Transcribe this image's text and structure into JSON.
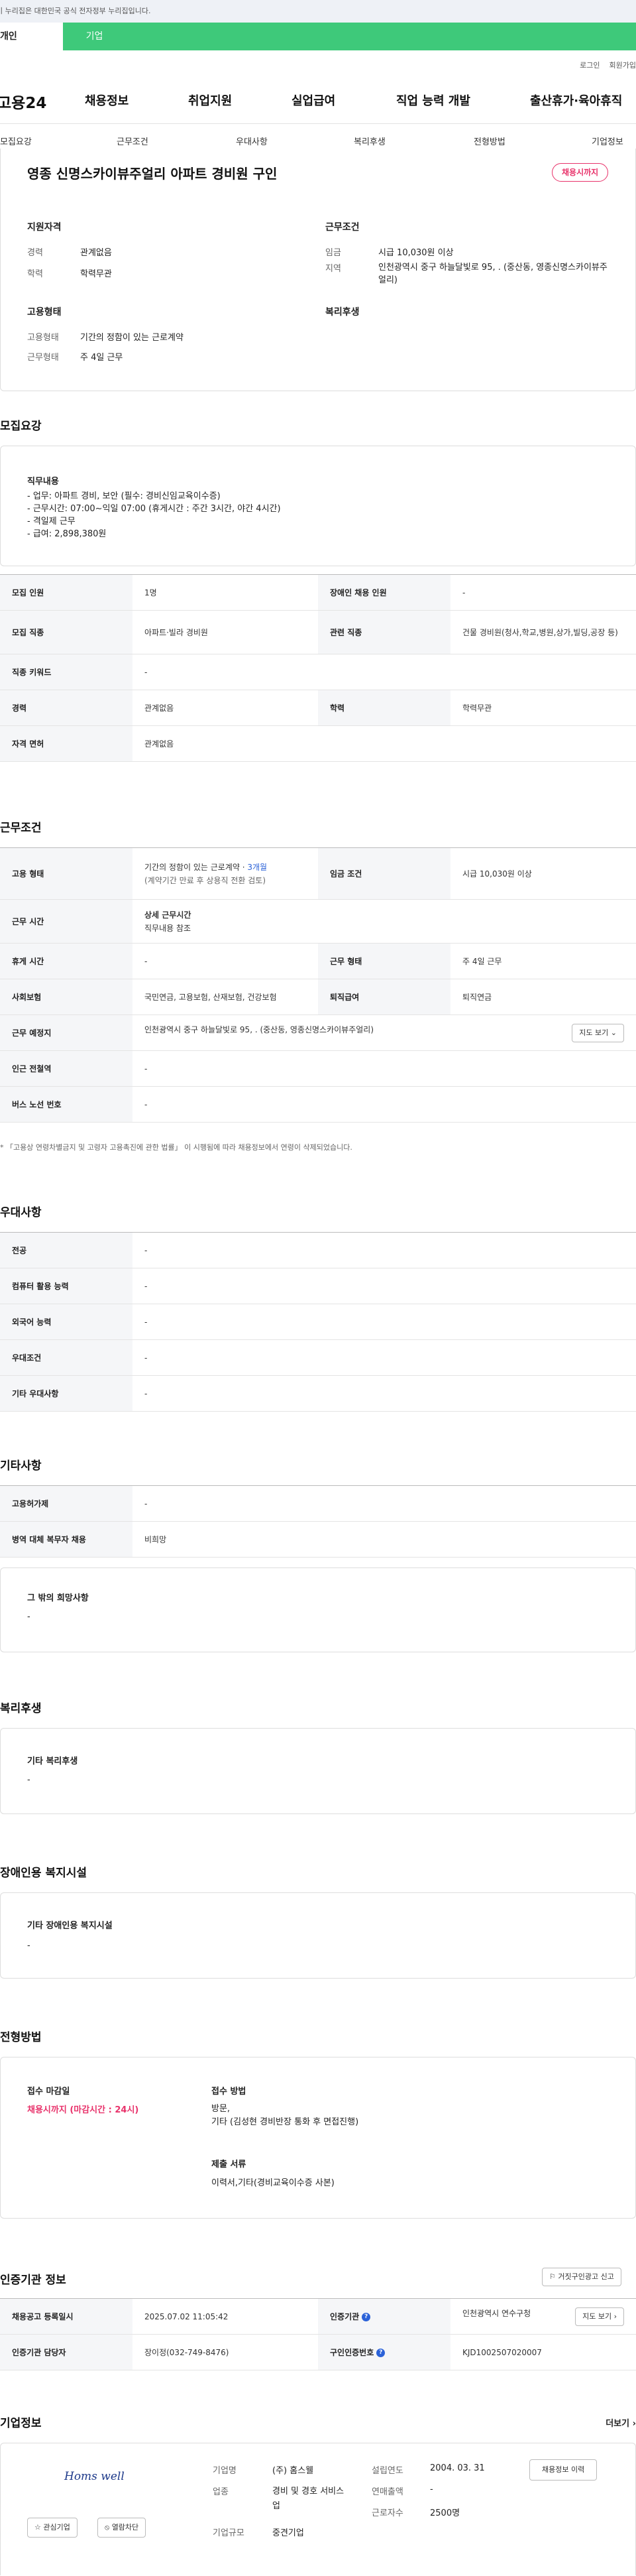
{
  "gov_banner": "이 누리집은 대한민국 공식 전자정부 누리집입니다.",
  "user_tabs": [
    "개인",
    "기업"
  ],
  "header": {
    "logo": "고용24",
    "util": [
      "로그인",
      "회원가입"
    ],
    "gnb": [
      "채용정보",
      "취업지원",
      "실업급여",
      "직업 능력 개발",
      "출산휴가·육아휴직"
    ]
  },
  "snb": [
    "모집요강",
    "근무조건",
    "우대사항",
    "복리후생",
    "전형방법",
    "기업정보"
  ],
  "job": {
    "title": "영종 신명스카이뷰주얼리 아파트 경비원 구인",
    "badge": "채용시까지",
    "qual_head": "지원자격",
    "exp_label": "경력",
    "exp": "관계없음",
    "edu_label": "학력",
    "edu": "학력무관",
    "work_head": "근무조건",
    "wage_label": "임금",
    "wage": "시급 10,030원 이상",
    "region_label": "지역",
    "region": "인천광역시 중구 하늘달빛로 95, . (중산동, 영종신명스카이뷰주얼리)",
    "emp_head": "고용형태",
    "type_label": "고용형태",
    "type": "기간의 정함이 있는 근로계약",
    "days_label": "근무형태",
    "days": "주 4일 근무",
    "welfare_head": "복리후생"
  },
  "recruit": {
    "section": "모집요강",
    "duty_head": "직무내용",
    "duty_lines": [
      "- 업무: 아파트 경비, 보안 (필수: 경비신임교육이수증)",
      "- 근무시간: 07:00~익일 07:00 (휴게시간 : 주간 3시간, 야간 4시간)",
      "- 격일제 근무",
      "- 급여: 2,898,380원"
    ],
    "rows": [
      [
        "모집 인원",
        "1명",
        "장애인 채용 인원",
        "-"
      ],
      [
        "모집 직종",
        "아파트·빌라 경비원",
        "관련 직종",
        "건물 경비원(청사,학교,병원,상가,빌딩,공장 등)"
      ],
      [
        "직종 키워드",
        "-",
        "",
        ""
      ],
      [
        "경력",
        "관계없음",
        "학력",
        "학력무관"
      ],
      [
        "자격 면허",
        "관계없음",
        "",
        ""
      ]
    ]
  },
  "work": {
    "section": "근무조건",
    "contract": "기간의 정함이 있는 근로계약 · ",
    "contract_len": "3개월",
    "contract_note": "(계약기간 만료 후 상용직 전환 검토)",
    "rows": {
      "emp_type": "고용 형태",
      "wage_cond": "임금 조건",
      "wage": "시급 10,030원 이상",
      "hours": "근무 시간",
      "hours_v1": "상세 근무시간",
      "hours_v2": "직무내용 참조",
      "rest": "휴게 시간",
      "rest_v": "-",
      "form": "근무 형태",
      "form_v": "주 4일 근무",
      "ins": "사회보험",
      "ins_v": "국민연금, 고용보험, 산재보험, 건강보험",
      "ret": "퇴직급여",
      "ret_v": "퇴직연금",
      "place": "근무 예정지",
      "place_v": "인천광역시 중구 하늘달빛로 95, . (중산동, 영종신명스카이뷰주얼리)",
      "map_btn": "지도 보기",
      "subway": "인근 전철역",
      "subway_v": "-",
      "bus": "버스 노선 번호",
      "bus_v": "-"
    },
    "note": "「고용상 연령차별금지 및 고령자 고용촉진에 관한 법률」 이 시행됨에 따라 채용정보에서 연령이 삭제되었습니다."
  },
  "pref": {
    "section": "우대사항",
    "rows": [
      [
        "전공",
        "-"
      ],
      [
        "컴퓨터 활용 능력",
        "-"
      ],
      [
        "외국어 능력",
        "-"
      ],
      [
        "우대조건",
        "-"
      ],
      [
        "기타 우대사항",
        "-"
      ]
    ]
  },
  "etc": {
    "section": "기타사항",
    "rows": [
      [
        "고용허가제",
        "-"
      ],
      [
        "병역 대체 복무자 채용",
        "비희망"
      ]
    ],
    "box_head": "그 밖의 희망사항",
    "box_v": "-"
  },
  "welfare": {
    "section": "복리후생",
    "box_head": "기타 복리후생",
    "box_v": "-"
  },
  "disabled": {
    "section": "장애인용 복지시설",
    "box_head": "기타 장애인용 복지시설",
    "box_v": "-"
  },
  "select": {
    "section": "전형방법",
    "deadline_head": "접수 마감일",
    "deadline_v": "채용시까지 (마감시간 : 24시)",
    "method_head": "접수 방법",
    "method_v1": "방문,",
    "method_v2": "기타 (김성현 경비반장 통화 후 면접진행)",
    "docs_head": "제출 서류",
    "docs_v": "이력서,기타(경비교육이수증 사본)"
  },
  "cert": {
    "section": "인증기관 정보",
    "report_btn": "거짓구인광고 신고",
    "reg_label": "채용공고 등록일시",
    "reg_v": "2025.07.02 11:05:42",
    "org_label": "인증기관",
    "org_v": "인천광역시 연수구청",
    "map_btn": "지도 보기",
    "mgr_label": "인증기관 담당자",
    "mgr_v": "장이정(032-749-8476)",
    "no_label": "구인인증번호",
    "no_v": "KJD1002507020007"
  },
  "company": {
    "section": "기업정보",
    "more": "더보기",
    "logo_text": "Homs well",
    "name_l": "기업명",
    "name_v": "(주) 홈스웰",
    "ind_l": "업종",
    "ind_v": "경비 및 경호 서비스업",
    "size_l": "기업규모",
    "size_v": "중견기업",
    "est_l": "설립연도",
    "est_v": "2004. 03. 31",
    "rev_l": "연매출액",
    "rev_v": "-",
    "emp_l": "근로자수",
    "emp_v": "2500명",
    "hist_btn": "채용정보 이력",
    "fav_btn": "관심기업",
    "block_btn": "열람차단"
  },
  "colors": {
    "green": "#3ec97a",
    "accent": "#e8336b",
    "blue": "#2b62d8"
  }
}
